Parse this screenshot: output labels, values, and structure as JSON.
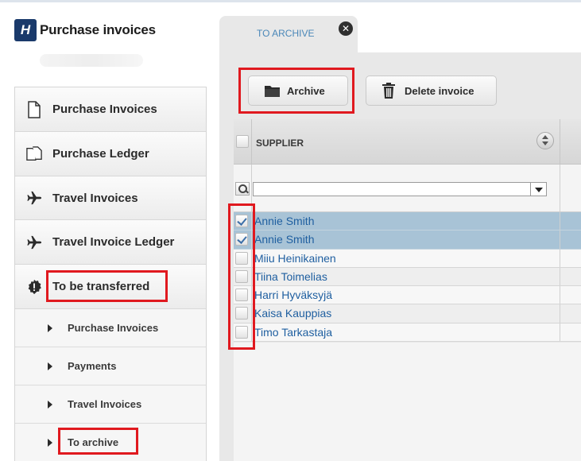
{
  "app": {
    "logo_letter": "H",
    "title": "Purchase invoices"
  },
  "sidebar": {
    "items": [
      {
        "label": "Purchase Invoices",
        "icon": "document-icon"
      },
      {
        "label": "Purchase Ledger",
        "icon": "documents-icon"
      },
      {
        "label": "Travel Invoices",
        "icon": "airplane-icon"
      },
      {
        "label": "Travel Invoice Ledger",
        "icon": "airplane-icon"
      },
      {
        "label": "To be transferred",
        "icon": "alert-badge-icon"
      }
    ],
    "subitems": [
      {
        "label": "Purchase Invoices"
      },
      {
        "label": "Payments"
      },
      {
        "label": "Travel Invoices"
      },
      {
        "label": "To archive"
      }
    ]
  },
  "tab": {
    "label": "TO ARCHIVE",
    "close_symbol": "✕"
  },
  "toolbar": {
    "archive_label": "Archive",
    "delete_label": "Delete invoice"
  },
  "grid": {
    "column_header": "SUPPLIER",
    "filter_value": "",
    "rows": [
      {
        "supplier": "Annie Smith",
        "checked": true
      },
      {
        "supplier": "Annie Smith",
        "checked": true
      },
      {
        "supplier": "Miiu Heinikainen",
        "checked": false
      },
      {
        "supplier": "Tiina Toimelias",
        "checked": false
      },
      {
        "supplier": "Harri Hyväksyjä",
        "checked": false
      },
      {
        "supplier": "Kaisa Kauppias",
        "checked": false
      },
      {
        "supplier": "Timo Tarkastaja",
        "checked": false
      }
    ]
  },
  "colors": {
    "highlight": "#e0191f",
    "selected_row": "#a8c3d6",
    "link_text": "#1f5fa0",
    "brand": "#1a3a6b"
  }
}
